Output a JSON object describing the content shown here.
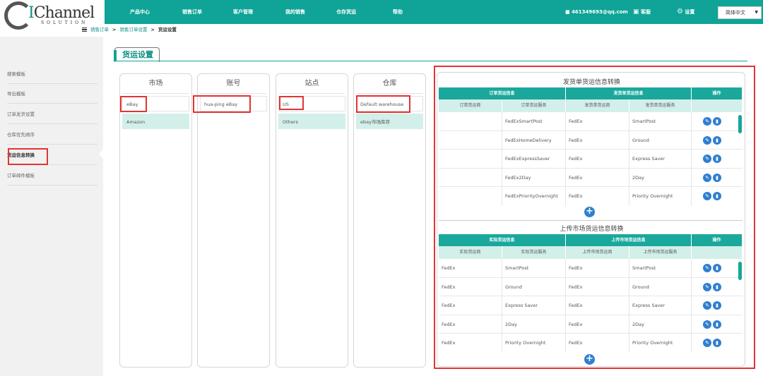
{
  "logo": {
    "text": "Channel",
    "sub": "SOLUTION"
  },
  "nav": [
    "产品中心",
    "销售订单",
    "客户管理",
    "我的销售",
    "仓存货运",
    "帮助"
  ],
  "user": {
    "email": "461349693@qq.com",
    "service": "客服",
    "settings": "设置",
    "language": "简体中文"
  },
  "breadcrumb": [
    "销售订单",
    "销售订单设置",
    "货运设置"
  ],
  "sidebar": [
    "搜索模板",
    "导出模板",
    "订单发货设置",
    "仓库优先顺序",
    "货运信息转换",
    "订单邮件模板"
  ],
  "page_title": "货运设置",
  "columns": {
    "market": {
      "header": "市场",
      "items": [
        "eBay",
        "Amazon"
      ]
    },
    "account": {
      "header": "账号",
      "items": [
        "hua-ping eBay"
      ]
    },
    "site": {
      "header": "站点",
      "items": [
        "US",
        "Others"
      ]
    },
    "warehouse": {
      "header": "仓库",
      "items": [
        "Default warehouse",
        "ebay市场库存"
      ]
    }
  },
  "shipment_table": {
    "title": "发货单货运信息转换",
    "group_headers": [
      "订单货运信息",
      "发货单货运信息",
      "操作"
    ],
    "sub_headers": [
      "订单货运商",
      "订单货运服务",
      "发货单货运商",
      "发货单货运服务"
    ],
    "rows": [
      [
        "",
        "FedExSmartPost",
        "FedEx",
        "SmartPost"
      ],
      [
        "",
        "FedExHomeDelivery",
        "FedEx",
        "Ground"
      ],
      [
        "",
        "FedExExpressSaver",
        "FedEx",
        "Express Saver"
      ],
      [
        "",
        "FedEx2Day",
        "FedEx",
        "2Day"
      ],
      [
        "",
        "FedExPriorityOvernight",
        "FedEx",
        "Priority Overnight"
      ]
    ]
  },
  "upload_table": {
    "title": "上传市场货运信息转换",
    "group_headers": [
      "实际货运信息",
      "上传市场货运信息",
      "操作"
    ],
    "sub_headers": [
      "实际货运商",
      "实际货运服务",
      "上传市场货运商",
      "上传市场货运服务"
    ],
    "rows": [
      [
        "FedEx",
        "SmartPost",
        "FedEx",
        "SmartPost"
      ],
      [
        "FedEx",
        "Ground",
        "FedEx",
        "Ground"
      ],
      [
        "FedEx",
        "Express Saver",
        "FedEx",
        "Express Saver"
      ],
      [
        "FedEx",
        "2Day",
        "FedEx",
        "2Day"
      ],
      [
        "FedEx",
        "Priority Overnight",
        "FedEx",
        "Priority Overnight"
      ]
    ]
  },
  "colors": {
    "brand": "#0fa497",
    "highlight": "#e03434",
    "action": "#2f7fd0"
  }
}
